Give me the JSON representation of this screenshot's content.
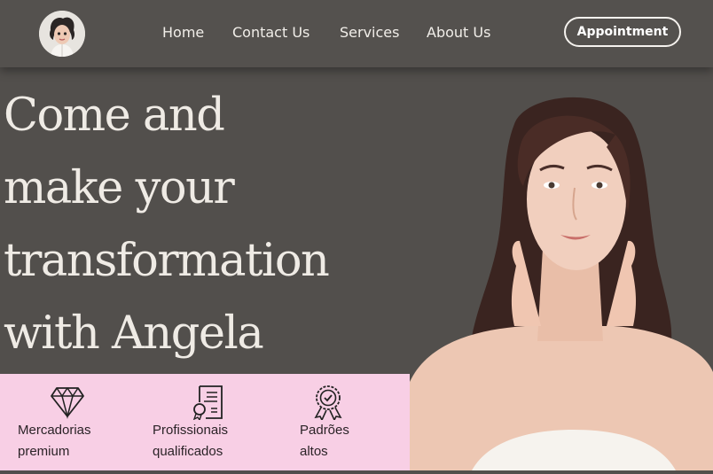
{
  "nav": {
    "items": [
      "Home",
      "Contact Us",
      "Services",
      "About Us"
    ],
    "cta": "Appointment"
  },
  "hero": {
    "lines": [
      "Come and",
      "make your",
      "transformation",
      "with Angela"
    ]
  },
  "features": [
    {
      "icon": "diamond-icon",
      "line1": "Mercadorias",
      "line2": "premium"
    },
    {
      "icon": "certificate-document-icon",
      "line1": "Profissionais",
      "line2": "qualificados"
    },
    {
      "icon": "award-ribbon-icon",
      "line1": "Padrões",
      "line2": "altos"
    }
  ],
  "colors": {
    "background": "#524f4c",
    "feature_band": "#f8cfe5",
    "text_light": "#f3efe9"
  }
}
